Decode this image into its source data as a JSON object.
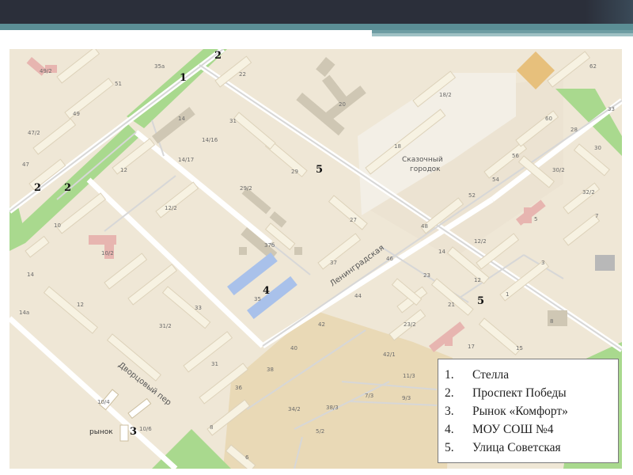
{
  "slide": {
    "top_bar_color": "#2b2f3a",
    "accent_color": "#5b8e95"
  },
  "map": {
    "markers": [
      {
        "id": "m1",
        "label": "1"
      },
      {
        "id": "m2a",
        "label": "2"
      },
      {
        "id": "m2b",
        "label": "2"
      },
      {
        "id": "m2c",
        "label": "2"
      },
      {
        "id": "m3",
        "label": "3"
      },
      {
        "id": "m4",
        "label": "4"
      },
      {
        "id": "m5a",
        "label": "5"
      },
      {
        "id": "m5b",
        "label": "5"
      }
    ],
    "streets": {
      "leningradskaya": "Ленинградская",
      "dvortsovy": "Дворцовый пер"
    },
    "places": {
      "skazochny_line1": "Сказочный",
      "skazochny_line2": "городок",
      "rynok": "рынок"
    },
    "house_numbers": [
      "49/2",
      "35а",
      "51",
      "22",
      "20",
      "18/2",
      "62",
      "33",
      "49",
      "47/2",
      "14",
      "31",
      "14/16",
      "14/17",
      "18",
      "60",
      "28",
      "30",
      "56",
      "30/2",
      "47",
      "12",
      "29",
      "54",
      "32/2",
      "52",
      "29/2",
      "5",
      "7",
      "12/2",
      "10",
      "27",
      "48",
      "12/2",
      "10/2",
      "37б",
      "46",
      "14",
      "3",
      "14",
      "37",
      "23",
      "12",
      "44",
      "1",
      "8",
      "14а",
      "12",
      "35",
      "21",
      "42",
      "23/2",
      "33",
      "40",
      "42/1",
      "17",
      "15",
      "31/2",
      "31",
      "38",
      "11/3",
      "36",
      "7/3",
      "9/3",
      "10/4",
      "34/2",
      "38/3",
      "10/6",
      "8",
      "5/2",
      "6"
    ]
  },
  "legend": {
    "items": [
      {
        "num": "1.",
        "text": "Стелла"
      },
      {
        "num": "2.",
        "text": "Проспект Победы"
      },
      {
        "num": "3.",
        "text": "Рынок «Комфорт»"
      },
      {
        "num": "4.",
        "text": "МОУ СОШ №4"
      },
      {
        "num": "5.",
        "text": "Улица Советская"
      }
    ]
  }
}
